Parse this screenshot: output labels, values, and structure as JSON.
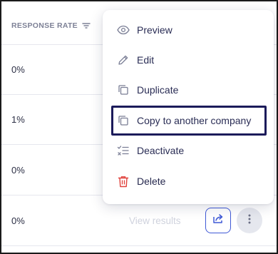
{
  "table": {
    "column_header": "RESPONSE RATE",
    "rows": [
      {
        "rate": "0%"
      },
      {
        "rate": "1%"
      },
      {
        "rate": "0%"
      },
      {
        "rate": "0%"
      }
    ],
    "view_results_label": "View results"
  },
  "menu": {
    "items": [
      {
        "label": "Preview",
        "icon": "eye-icon"
      },
      {
        "label": "Edit",
        "icon": "pencil-icon"
      },
      {
        "label": "Duplicate",
        "icon": "copy-icon"
      },
      {
        "label": "Copy to another company",
        "icon": "copy-icon"
      },
      {
        "label": "Deactivate",
        "icon": "deactivate-list-icon"
      },
      {
        "label": "Delete",
        "icon": "trash-icon"
      }
    ]
  },
  "colors": {
    "menu_text": "#2a2d55",
    "delete_icon": "#e0413b",
    "share_border": "#3f59d6",
    "highlight_border": "#1c1b5a"
  }
}
